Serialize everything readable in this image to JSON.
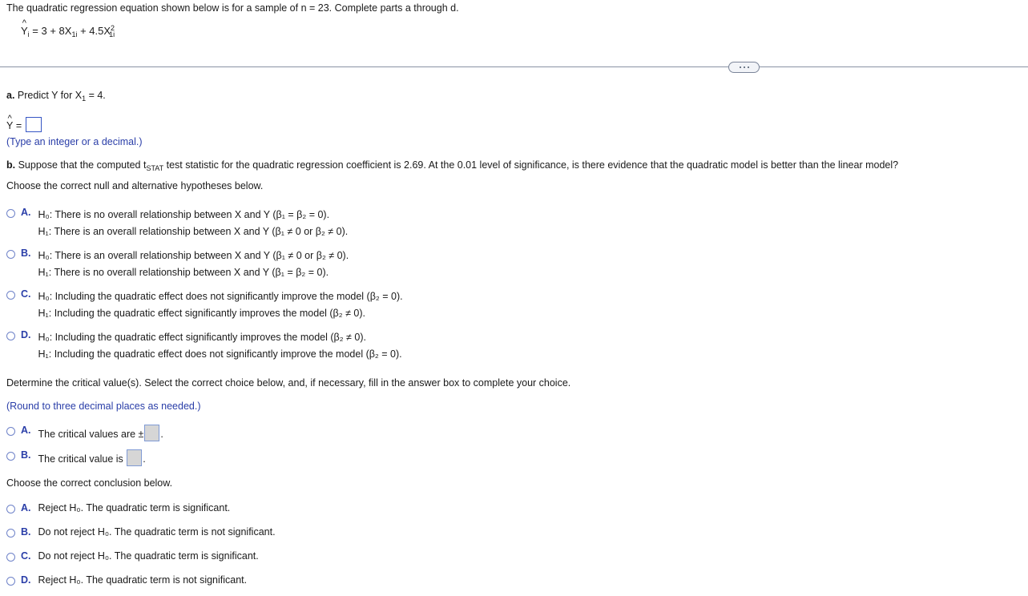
{
  "header": {
    "prompt": "The quadratic regression equation shown below is for a sample of n = 23. Complete parts a through d.",
    "equation_plain": "Ŷi = 3 + 8X1i + 4.5X1i²",
    "equation": {
      "lhs_var": "Y",
      "lhs_sub": "i",
      "rhs": "= 3 + 8X",
      "term1_sub": "1i",
      "plus": "+ 4.5X",
      "term2_sub": "1i",
      "term2_sup": "2"
    }
  },
  "divider": {
    "dots_label": "more-options"
  },
  "part_a": {
    "label": "a.",
    "text": "Predict Y for X",
    "sub": "1",
    "tail": "= 4.",
    "answer_prefix": "Ŷ =",
    "answer_value": "",
    "hint": "(Type an integer or a decimal.)"
  },
  "part_b": {
    "label": "b.",
    "text_before": "Suppose that the computed t",
    "subscript": "STAT",
    "text_after": "test statistic for the quadratic regression coefficient is 2.69. At the 0.01 level of significance, is there evidence that the quadratic model is better than the linear model?",
    "instruction": "Choose the correct null and alternative hypotheses below."
  },
  "hypotheses": {
    "options": [
      {
        "letter": "A.",
        "line1": "H₀: There is no overall relationship between X and Y (β₁ = β₂ = 0).",
        "line2": "H₁: There is an overall relationship between X and Y (β₁ ≠ 0 or β₂ ≠ 0)."
      },
      {
        "letter": "B.",
        "line1": "H₀: There is an overall relationship between X and Y (β₁ ≠ 0 or β₂ ≠ 0).",
        "line2": "H₁: There is no overall relationship between X and Y (β₁ = β₂ = 0)."
      },
      {
        "letter": "C.",
        "line1": "H₀: Including the quadratic effect does not significantly improve the model (β₂ = 0).",
        "line2": "H₁: Including the quadratic effect significantly improves the model (β₂ ≠ 0)."
      },
      {
        "letter": "D.",
        "line1": "H₀: Including the quadratic effect significantly improves the model (β₂ ≠ 0).",
        "line2": "H₁: Including the quadratic effect does not significantly improve the model (β₂ = 0)."
      }
    ]
  },
  "critical_value": {
    "instruction": "Determine the critical value(s). Select the correct choice below, and, if necessary, fill in the answer box to complete your choice.",
    "rounding_note": "(Round to three decimal places as needed.)",
    "options": [
      {
        "letter": "A.",
        "text_before": "The critical values are  ±",
        "text_after": ".",
        "value": ""
      },
      {
        "letter": "B.",
        "text_before": "The critical value is",
        "text_after": ".",
        "value": ""
      }
    ]
  },
  "conclusion": {
    "instruction": "Choose the correct conclusion below.",
    "options": [
      {
        "letter": "A.",
        "text": "Reject H₀. The quadratic term is significant."
      },
      {
        "letter": "B.",
        "text": "Do not reject H₀. The quadratic term is not significant."
      },
      {
        "letter": "C.",
        "text": "Do not reject H₀. The quadratic term is significant."
      },
      {
        "letter": "D.",
        "text": "Reject H₀. The quadratic term is not significant."
      }
    ]
  },
  "colors": {
    "accent_blue": "#2a3ea8",
    "radio_blue": "#6f83c9",
    "divider_grey": "#8a93a5",
    "answer_box_border": "#3656c4",
    "answer_box_grey": "#d6d6d6",
    "text": "#1a1a1a"
  }
}
